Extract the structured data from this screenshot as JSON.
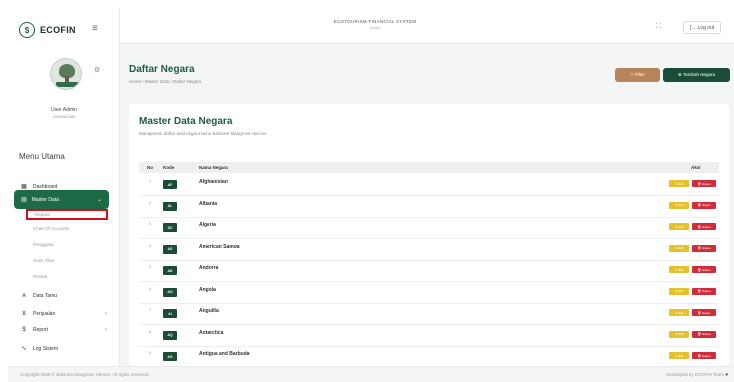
{
  "brand": {
    "name": "ECOFIN",
    "logo_icon": "leaf-circle-icon"
  },
  "topbar": {
    "system_title": "ECOTOURISM FINANCIAL SYSTEM",
    "system_subtitle": "Ecofin",
    "logout_label": "[→ Log out"
  },
  "user": {
    "name": "User Admin",
    "id": "9295561885"
  },
  "menu": {
    "title": "Menu Utama",
    "items": [
      {
        "label": "Dashboard",
        "icon": "grid-icon"
      },
      {
        "label": "Master Data",
        "icon": "database-icon",
        "active": true
      },
      {
        "label": "Data Tamu",
        "icon": "users-icon"
      },
      {
        "label": "Penjualan",
        "icon": "cart-icon"
      },
      {
        "label": "Report",
        "icon": "dollar-icon"
      },
      {
        "label": "Log Sistem",
        "icon": "activity-icon"
      }
    ],
    "submenu": [
      "Negara",
      "Chart Of Accounts",
      "Pengguna",
      "Jenis Tiket",
      "Produk"
    ]
  },
  "page": {
    "title": "Daftar Negara",
    "breadcrumb": "Home / Master Data / Daftar Negara",
    "filter_label": "▽ Filter",
    "add_label": "⊕ Tambah Negara"
  },
  "card": {
    "title": "Master Data Negara",
    "description": "Manajemen daftar asal negara tamu Balaram Mangrove Heroes"
  },
  "table": {
    "headers": {
      "no": "No",
      "code": "Kode",
      "name": "Nama Negara",
      "action": "Aksi"
    },
    "edit_label": "✎ Edit",
    "delete_label": "🗑 Hapus",
    "rows": [
      {
        "no": "1",
        "code": "AF",
        "name": "Afghanistan"
      },
      {
        "no": "2",
        "code": "AL",
        "name": "Albania"
      },
      {
        "no": "3",
        "code": "DZ",
        "name": "Algeria"
      },
      {
        "no": "4",
        "code": "AS",
        "name": "American Samoa"
      },
      {
        "no": "5",
        "code": "AD",
        "name": "Andorra"
      },
      {
        "no": "6",
        "code": "AO",
        "name": "Angola"
      },
      {
        "no": "7",
        "code": "AI",
        "name": "Anguilla"
      },
      {
        "no": "8",
        "code": "AQ",
        "name": "Antarctica"
      },
      {
        "no": "9",
        "code": "AG",
        "name": "Antigua and Barbuda"
      }
    ]
  },
  "footer": {
    "left": "Copyright 2026 © Balaram Mangrove Heroes. All rights reserved.",
    "right": "Developed by ECOFIN Team",
    "heart_icon": "heart-icon"
  },
  "colors": {
    "primary": "#1d6a47",
    "dark_green": "#1a4c36",
    "filter": "#b8845a",
    "edit": "#e6c12e",
    "delete": "#d12c3b",
    "highlight_box": "#d0101d"
  }
}
